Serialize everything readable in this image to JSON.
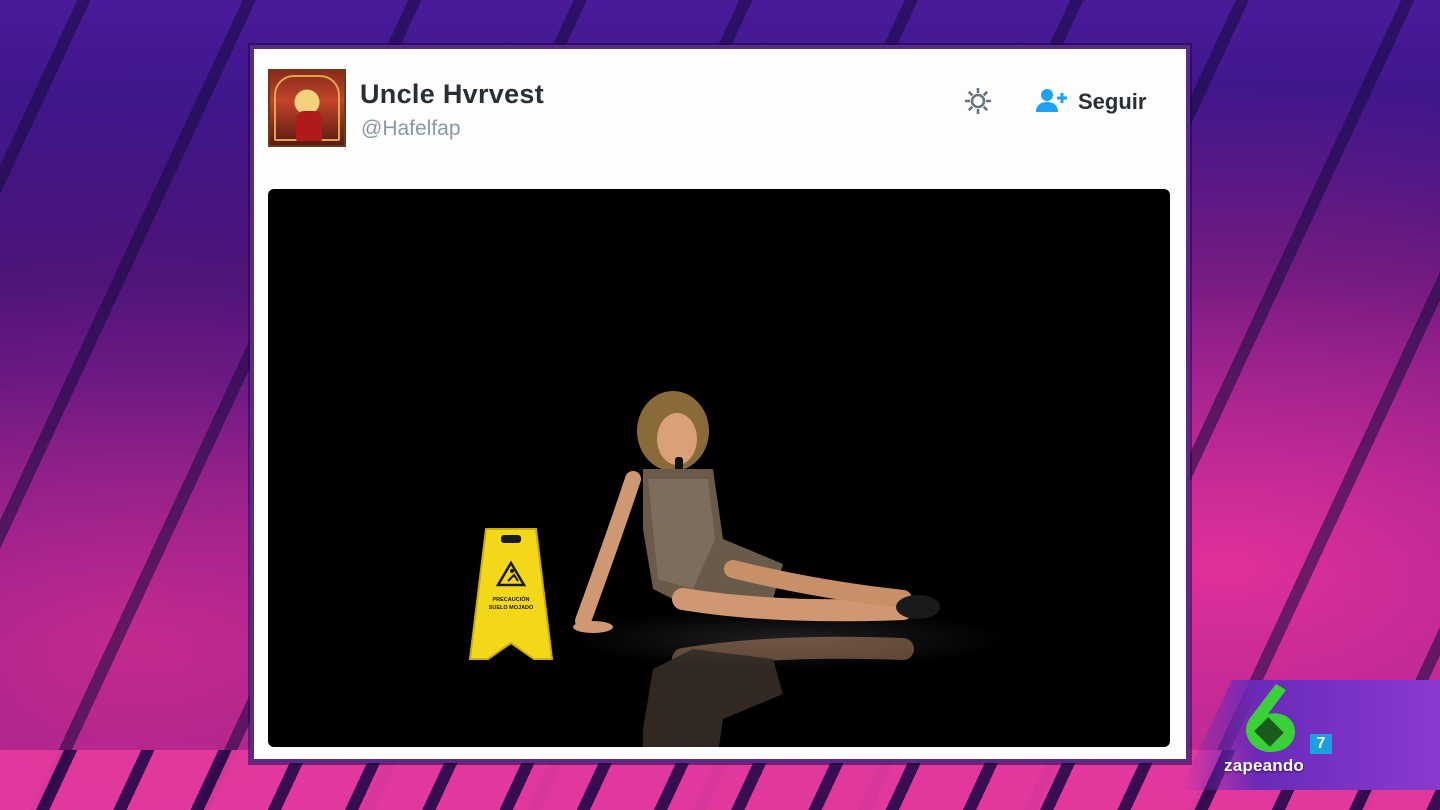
{
  "tweet": {
    "user_name": "Uncle Hvrvest",
    "user_handle": "@Hafelfap",
    "follow_label": "Seguir",
    "settings_icon": "gear-icon",
    "follow_icon": "add-user-icon"
  },
  "media": {
    "sign_text": "PRECAUCIÓN SUELO MOJADO"
  },
  "channel": {
    "logo_number": "6",
    "badge": "7",
    "name": "zapeando"
  },
  "colors": {
    "card_bg": "#fdfdfd",
    "name_text": "#292f33",
    "handle_text": "#8899a6",
    "follow_icon": "#1da1f2",
    "logo_green": "#3ad03a",
    "logo_badge": "#1aa0e0"
  }
}
